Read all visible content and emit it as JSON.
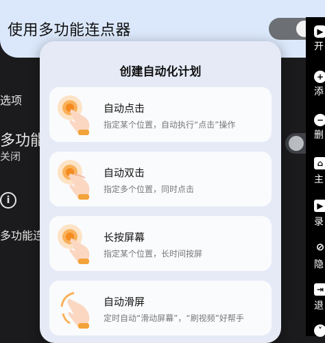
{
  "header": {
    "title": "使用多功能连点器"
  },
  "background": {
    "options_label": "选项",
    "feature_title": "多功能",
    "feature_status": "关闭",
    "info_icon": "info-icon",
    "feature_item": "多功能连"
  },
  "side_toolbar": {
    "items": [
      {
        "icon": "play-icon",
        "label": "开"
      },
      {
        "icon": "plus-icon",
        "label": "添"
      },
      {
        "icon": "minus-icon",
        "label": "删"
      },
      {
        "icon": "home-icon",
        "label": "主"
      },
      {
        "icon": "record-icon",
        "label": "录"
      },
      {
        "icon": "eye-off-icon",
        "label": "隐"
      },
      {
        "icon": "exit-icon",
        "label": "退"
      }
    ]
  },
  "modal": {
    "title": "创建自动化计划",
    "cards": [
      {
        "title": "自动点击",
        "desc": "指定某个位置，自动执行“点击”操作",
        "icon": "tap-hand-icon"
      },
      {
        "title": "自动双击",
        "desc": "指定多个位置，同时点击",
        "icon": "double-tap-hand-icon"
      },
      {
        "title": "长按屏幕",
        "desc": "指定某个位置，长时间按屏",
        "icon": "long-press-hand-icon"
      },
      {
        "title": "自动滑屏",
        "desc": "定时自动“滑动屏幕”，“刷视频”好帮手",
        "icon": "swipe-hand-icon"
      }
    ]
  },
  "colors": {
    "banner": "#dbe8fb",
    "modal_bg": "#e5eaf6",
    "card_bg": "#fafbfd",
    "accent_orange": "#f7a030"
  }
}
